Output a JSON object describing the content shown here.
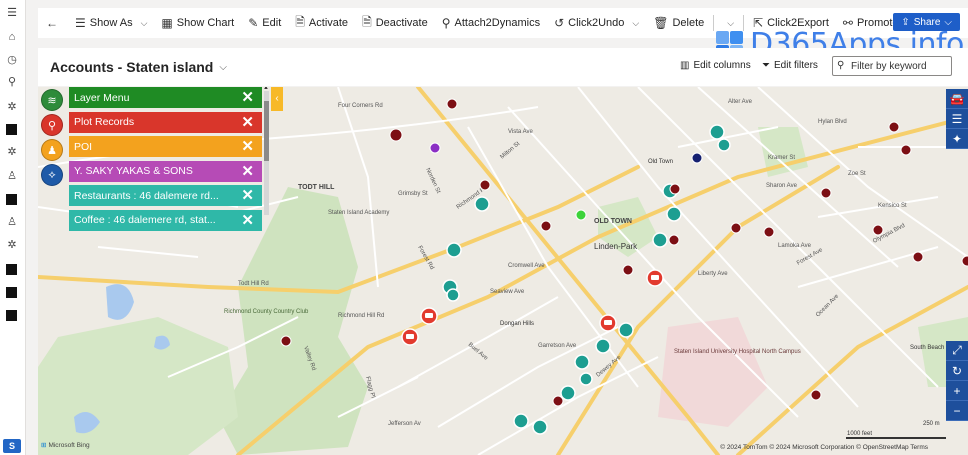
{
  "commandbar": {
    "back_icon": "back-arrow-icon",
    "items": [
      {
        "label": "Show As",
        "icon": "list-icon"
      },
      {
        "label": "Show Chart",
        "icon": "chart-icon"
      },
      {
        "label": "Edit",
        "icon": "pencil-icon"
      },
      {
        "label": "Activate",
        "icon": "doc-check-icon"
      },
      {
        "label": "Deactivate",
        "icon": "doc-x-icon"
      },
      {
        "label": "Attach2Dynamics",
        "icon": "paperclip-icon"
      },
      {
        "label": "Click2Undo",
        "icon": "undo-icon"
      },
      {
        "label": "Delete",
        "icon": "trash-icon"
      },
      {
        "label": "Click2Export",
        "icon": "export-icon"
      },
      {
        "label": "Promote",
        "icon": "promote-icon"
      }
    ],
    "share_label": "Share"
  },
  "watermark": {
    "text": "D365Apps.info"
  },
  "view": {
    "title": "Accounts - Staten island",
    "edit_columns": "Edit columns",
    "edit_filters": "Edit filters",
    "filter_placeholder": "Filter by keyword"
  },
  "layer_menu": {
    "rows": [
      {
        "label": "Layer Menu",
        "color": "#1f8b24"
      },
      {
        "label": "Plot Records",
        "color": "#d9362b"
      },
      {
        "label": "POI",
        "color": "#f3a21e"
      },
      {
        "label": "Y. SAKY YAKAS & SONS",
        "color": "#b64bb6"
      },
      {
        "label": "Restaurants : 46 dalemere rd...",
        "color": "#2fb8a8"
      },
      {
        "label": "Coffee : 46 dalemere rd, stat...",
        "color": "#2fb8a8"
      }
    ],
    "icons": [
      {
        "name": "layers-icon",
        "color": "#2e8b3a"
      },
      {
        "name": "plot-pin-icon",
        "color": "#d9362b"
      },
      {
        "name": "poi-icon",
        "color": "#f3a21e"
      },
      {
        "name": "route-icon",
        "color": "#1e5aa8"
      }
    ]
  },
  "map": {
    "labels": [
      "TODT HILL",
      "OLD TOWN",
      "Linden-Park",
      "Staten Island Academy",
      "Richmond County Country Club",
      "Staten Island University Hospital North Campus",
      "South Beach Wetland",
      "Dongan Hills",
      "Old Town",
      "Richmond Rd",
      "Todt Hill Rd",
      "Jefferson Av",
      "Olympia Blvd",
      "Hylan Blvd",
      "Seaview Ave",
      "Cromwell Ave",
      "Buel Ave",
      "Garretson Ave",
      "Vista Ave",
      "Flagg Pl",
      "Valley Rd",
      "Richmond Hill Rd",
      "Forest Rd",
      "Four Corners Rd",
      "Norden St",
      "Milton St",
      "Sharon Ave",
      "Alter Ave",
      "Liberty Ave",
      "Dewey Ave",
      "Lamoka Ave",
      "Ocean Ave",
      "Forest Ave",
      "Zoe St",
      "Grimsby St",
      "Kramer St",
      "Kensico St"
    ],
    "attribution": "© 2024 TomTom  © 2024 Microsoft Corporation  © OpenStreetMap  Terms",
    "provider": "Microsoft Bing",
    "scale_feet": "1000 feet",
    "scale_m": "250 m"
  },
  "right_controls": [
    "car-icon",
    "list-icon",
    "star-icon"
  ],
  "zoom_controls": [
    "fullscreen-icon",
    "rotate-icon",
    "zoom-in-icon",
    "zoom-out-icon"
  ]
}
